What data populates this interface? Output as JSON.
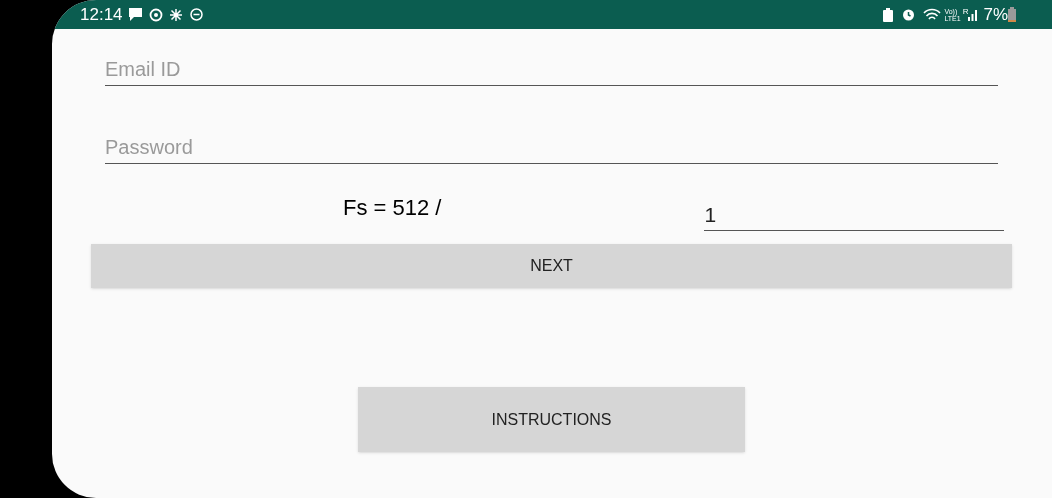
{
  "status_bar": {
    "time": "12:14",
    "volte": "Vo))",
    "lte": "LTE1",
    "roaming": "R",
    "battery": "7%"
  },
  "email": {
    "placeholder": "Email ID"
  },
  "password": {
    "placeholder": "Password"
  },
  "fs": {
    "label": "Fs = 512 /",
    "value": "1"
  },
  "buttons": [
    {
      "label": "NEXT"
    },
    {
      "label": "INSTRUCTIONS"
    }
  ]
}
